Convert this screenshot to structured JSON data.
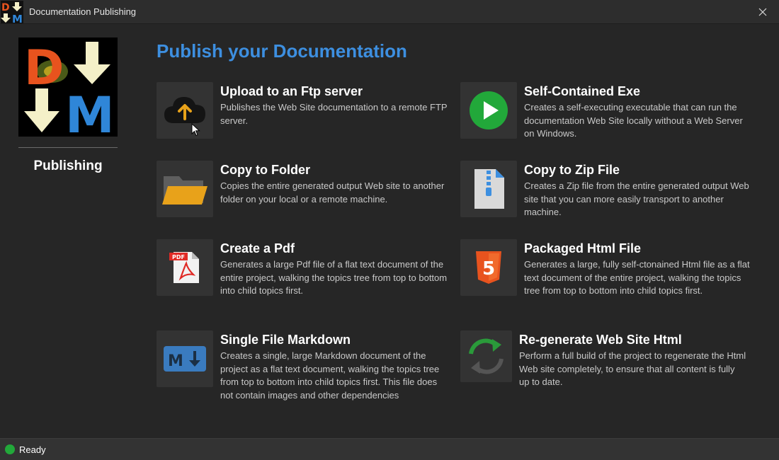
{
  "window": {
    "title": "Documentation Publishing",
    "close_icon": "close-icon"
  },
  "app_icon": {
    "letters": [
      "D",
      "M"
    ]
  },
  "sidebar": {
    "logo": {
      "letters": [
        "D",
        "M"
      ]
    },
    "label": "Publishing"
  },
  "main": {
    "title": "Publish your Documentation",
    "cards": [
      {
        "icon": "cloud-upload-icon",
        "title": "Upload to an Ftp server",
        "description": "Publishes the Web Site documentation to a remote FTP server."
      },
      {
        "icon": "play-icon",
        "title": "Self-Contained Exe",
        "description": "Creates a self-executing executable that can run the documentation Web Site locally without a Web Server on Windows."
      },
      {
        "icon": "folder-icon",
        "title": "Copy to Folder",
        "description": "Copies the entire generated output Web site to another folder on your local or a remote machine."
      },
      {
        "icon": "zip-file-icon",
        "title": "Copy to Zip File",
        "description": "Creates a Zip file from the entire generated output Web site that you can more easily transport to another machine."
      },
      {
        "icon": "pdf-icon",
        "icon_text": "PDF",
        "title": "Create a Pdf",
        "description": "Generates a large Pdf file of a flat text document of the entire project, walking the topics tree from top to bottom into child topics first."
      },
      {
        "icon": "html5-icon",
        "icon_text": "5",
        "title": "Packaged Html File",
        "description": "Generates a large, fully self-ctonained Html file as a flat text document of the entire project, walking the topics tree from top to bottom into child topics first."
      },
      {
        "icon": "markdown-icon",
        "icon_text": "M",
        "title": "Single File Markdown",
        "description": "Creates a single, large Markdown document of the project as a flat text document, walking the topics tree from top to bottom into child topics first. This file does not contain images and other dependencies"
      },
      {
        "icon": "refresh-icon",
        "title": "Re-generate Web Site Html",
        "description": "Perform a full build of the project to regenerate the Html Web site completely, to ensure that all content is fully up to date."
      }
    ]
  },
  "status": {
    "text": "Ready",
    "color": "#22a83a"
  },
  "colors": {
    "accent": "#3d8fe0",
    "background": "#262626",
    "tile": "#333333"
  }
}
